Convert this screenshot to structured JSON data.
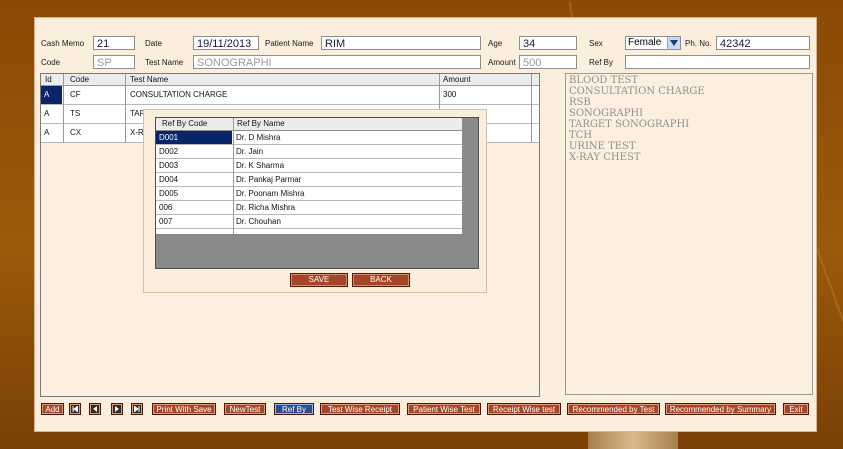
{
  "header": {
    "cash_memo_label": "Cash Memo",
    "cash_memo_value": "21",
    "date_label": "Date",
    "date_value": "19/11/2013",
    "patient_name_label": "Patient Name",
    "patient_name_value": "RIM",
    "age_label": "Age",
    "age_value": "34",
    "sex_label": "Sex",
    "sex_value": "Female",
    "phone_label": "Ph. No.",
    "phone_value": "42342",
    "code_label": "Code",
    "code_value": "SP",
    "test_name_label": "Test Name",
    "test_name_value": "SONOGRAPHI",
    "amount_label": "Amount",
    "amount_value": "500",
    "ref_by_label": "Ref By",
    "ref_by_value": ""
  },
  "grid": {
    "columns": [
      "Id",
      "Code",
      "Test Name",
      "Amount"
    ],
    "rows": [
      {
        "id": "A",
        "code": "CF",
        "test_name": "CONSULTATION CHARGE",
        "amount": "300"
      },
      {
        "id": "A",
        "code": "TS",
        "test_name": "TAR",
        "amount": ""
      },
      {
        "id": "A",
        "code": "CX",
        "test_name": "X-RA",
        "amount": ""
      }
    ]
  },
  "test_list": [
    "BLOOD TEST",
    "CONSULTATION CHARGE",
    "RSB",
    "SONOGRAPHI",
    "TARGET SONOGRAPHI",
    "TCH",
    "URINE TEST",
    "X-RAY CHEST"
  ],
  "ref_popup": {
    "columns": [
      "Ref By Code",
      "Ref By Name"
    ],
    "rows": [
      {
        "code": "D001",
        "name": "Dr. D Mishra"
      },
      {
        "code": "D002",
        "name": "Dr. Jain"
      },
      {
        "code": "D003",
        "name": "Dr. K Sharma"
      },
      {
        "code": "D004",
        "name": "Dr. Pankaj Parmar"
      },
      {
        "code": "D005",
        "name": "Dr. Poonam Mishra"
      },
      {
        "code": "006",
        "name": "Dr. Richa Mishra"
      },
      {
        "code": "007",
        "name": "Dr. Chouhan"
      }
    ],
    "save_label": "SAVE",
    "back_label": "BACK"
  },
  "toolbar": {
    "add": "Add",
    "print_with_save": "Print With Save",
    "new_test": "NewTest",
    "ref_by": "Ref By",
    "test_wise_receipt": "Test Wise Receipt",
    "patient_wise_test": "Patient Wise Test",
    "receipt_wise_test": "Receipt Wise test",
    "recommended_by_test": "Recommended by Test",
    "recommended_by_summary": "Recommended by Summary",
    "exit": "Exit"
  },
  "icons": {
    "nav_first": "first-record-icon",
    "nav_prev": "previous-record-icon",
    "nav_next": "next-record-icon",
    "nav_last": "last-record-icon",
    "dropdown": "chevron-down-icon"
  },
  "colors": {
    "background": "#8a4a06",
    "form": "#fbeedd",
    "button": "#a4462a",
    "button_active": "#2f4a8a",
    "selection": "#0a246a"
  }
}
